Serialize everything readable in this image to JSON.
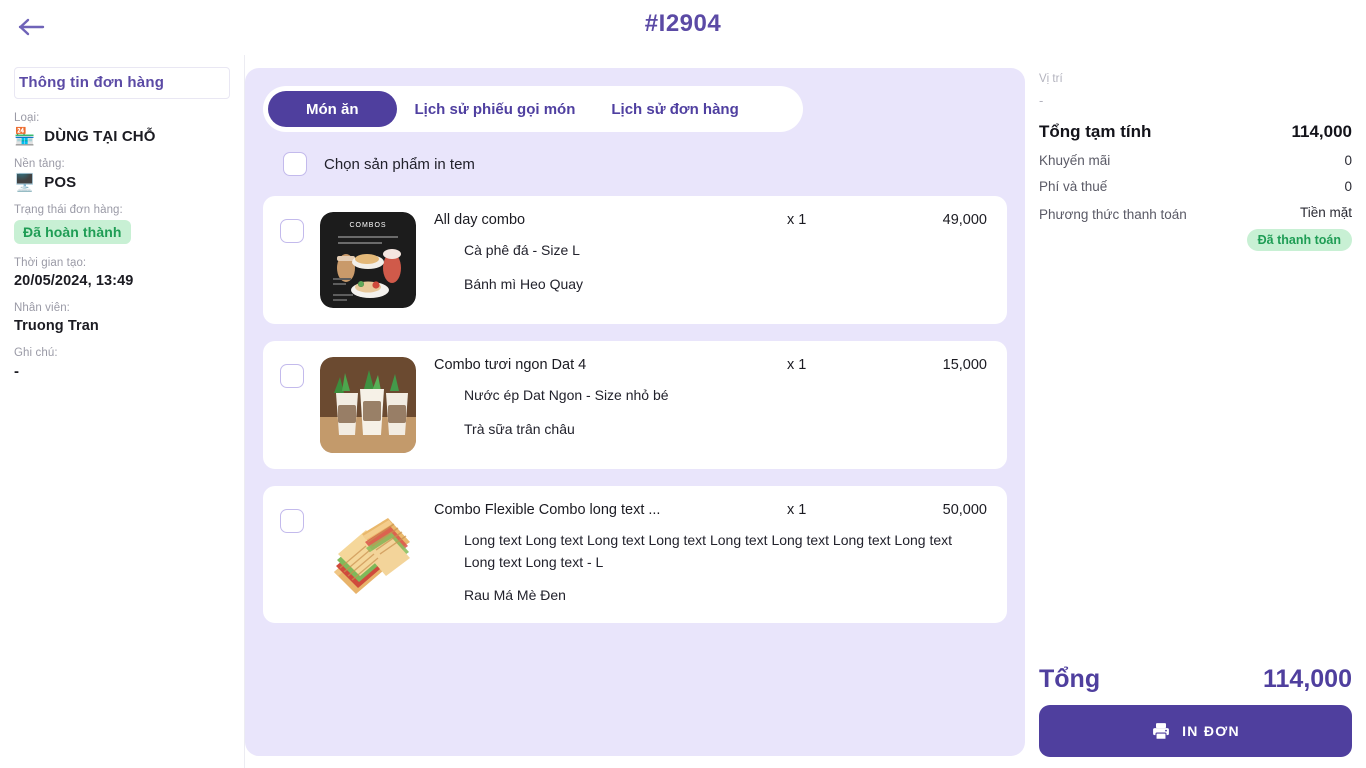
{
  "header": {
    "back_icon": "arrow-left-icon",
    "order_code": "#I2904"
  },
  "left_panel": {
    "section_title": "Thông tin đơn hàng",
    "fields": [
      {
        "label": "Loại:",
        "value": "DÙNG TẠI CHỖ",
        "icon": "🏪"
      },
      {
        "label": "Nền tảng:",
        "value": "POS",
        "icon": "🖥️"
      }
    ],
    "status": {
      "label": "Trạng thái đơn hàng:",
      "value": "Đã hoàn thành"
    },
    "created": {
      "label": "Thời gian tạo:",
      "value": "20/05/2024, 13:49"
    },
    "staff": {
      "label": "Nhân viên:",
      "value": "Truong Tran"
    },
    "note": {
      "label": "Ghi chú:",
      "value": "-"
    }
  },
  "center_panel": {
    "tabs": [
      {
        "label": "Món ăn",
        "active": true
      },
      {
        "label": "Lịch sử phiếu gọi món",
        "active": false
      },
      {
        "label": "Lịch sử đơn hàng",
        "active": false
      }
    ],
    "select_all_label": "Chọn sản phẩm in tem",
    "items": [
      {
        "name": "All day combo",
        "qty": "x 1",
        "price": "49,000",
        "image": "combo-dark-tray-photo",
        "options": [
          "Cà phê đá - Size L",
          "Bánh mì Heo Quay"
        ]
      },
      {
        "name": "Combo tươi ngon Dat 4",
        "qty": "x 1",
        "price": "15,000",
        "image": "juice-cups-photo",
        "options": [
          "Nước ép Dat Ngon - Size nhỏ bé",
          "Trà sữa trân châu"
        ]
      },
      {
        "name": "Combo Flexible Combo long text ...",
        "qty": "x 1",
        "price": "50,000",
        "image": "sandwich-photo",
        "options": [
          "Long text Long text Long text Long text Long text Long text Long text Long text Long text Long text  - L",
          "Rau Má Mè Đen"
        ]
      }
    ]
  },
  "right_panel": {
    "location_label": "Vị trí",
    "location_value": "-",
    "subtotal": {
      "label": "Tổng tạm tính",
      "value": "114,000"
    },
    "discount": {
      "label": "Khuyến mãi",
      "value": "0"
    },
    "fee_tax": {
      "label": "Phí và thuế",
      "value": "0"
    },
    "payment": {
      "label": "Phương thức thanh toán",
      "value": "Tiền mặt",
      "badge": "Đã thanh toán"
    },
    "grand_total": {
      "label": "Tổng",
      "value": "114,000"
    },
    "print_button": {
      "label": "IN ĐƠN",
      "icon": "printer-icon"
    }
  },
  "colors": {
    "accent": "#4f3f9e",
    "panel_bg": "#e9e5fb",
    "success": "#1f9d55",
    "success_bg": "#c8f0d4"
  }
}
